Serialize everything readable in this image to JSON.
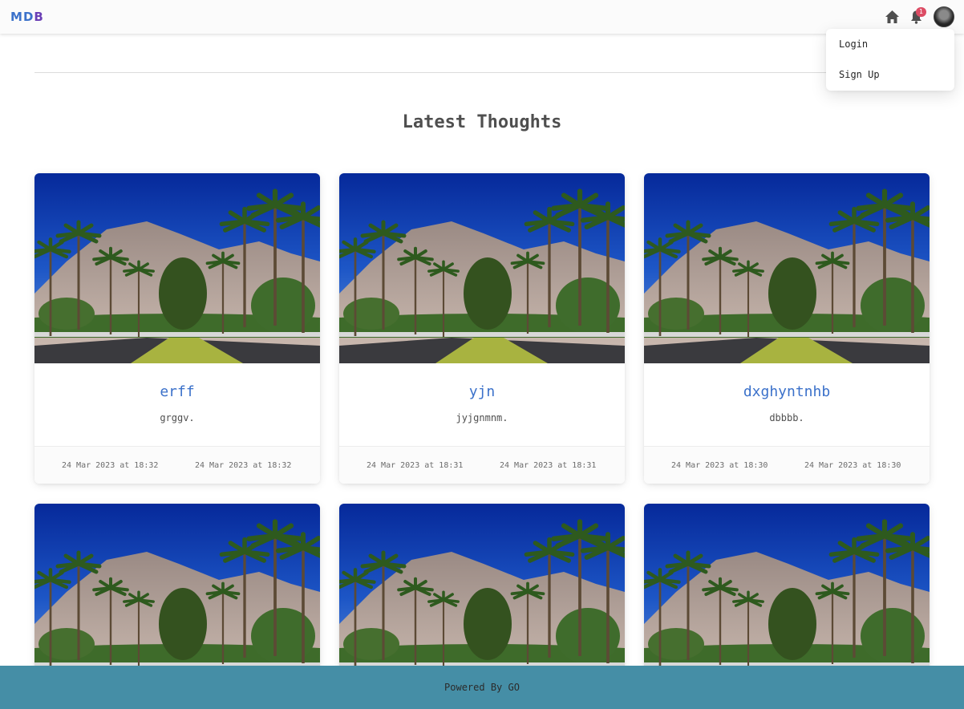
{
  "navbar": {
    "brand": [
      "M",
      "D",
      "B"
    ],
    "brand_colors": [
      "#3b71ca",
      "#3b71ca",
      "#6a3fb5"
    ],
    "notification_count": "1",
    "icons": [
      "home-icon",
      "bell-icon"
    ]
  },
  "dropdown": {
    "items": [
      "Login",
      "Sign Up"
    ]
  },
  "page": {
    "heading": "Latest Thoughts"
  },
  "cards": [
    {
      "title": "erff",
      "text": "grggv.",
      "created": "24 Mar 2023 at 18:32",
      "updated": "24 Mar 2023 at 18:32"
    },
    {
      "title": "yjn",
      "text": "jyjgnmnm.",
      "created": "24 Mar 2023 at 18:31",
      "updated": "24 Mar 2023 at 18:31"
    },
    {
      "title": "dxghyntnhb",
      "text": "dbbbb.",
      "created": "24 Mar 2023 at 18:30",
      "updated": "24 Mar 2023 at 18:30"
    }
  ],
  "footer": {
    "text": "Powered By GO"
  },
  "colors": {
    "primary": "#3b71ca",
    "footer_bg": "#458ea6",
    "badge": "#dc4c64"
  }
}
